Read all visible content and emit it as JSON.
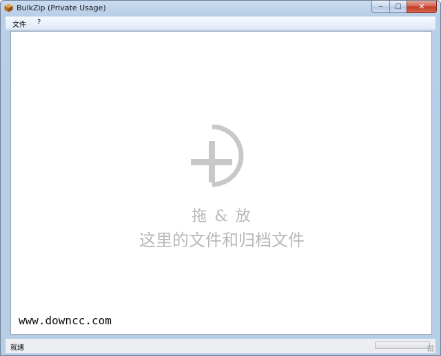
{
  "window": {
    "title": "BulkZip (Private Usage)",
    "app_icon": "package-box-icon",
    "caption_buttons": {
      "minimize": "–",
      "maximize": "□",
      "close": "✕"
    }
  },
  "menu": {
    "items": [
      {
        "label": "文件"
      },
      {
        "label": "?"
      }
    ]
  },
  "drop_zone": {
    "icon": "plus-drop-icon",
    "title": "拖 & 放",
    "subtitle": "这里的文件和归档文件"
  },
  "watermark": {
    "text": "www.downcc.com"
  },
  "status_bar": {
    "status": "就绪",
    "progress": 0
  },
  "colors": {
    "drop_hint": "#b8b8b8",
    "progress_fill": "#3fb13f"
  }
}
